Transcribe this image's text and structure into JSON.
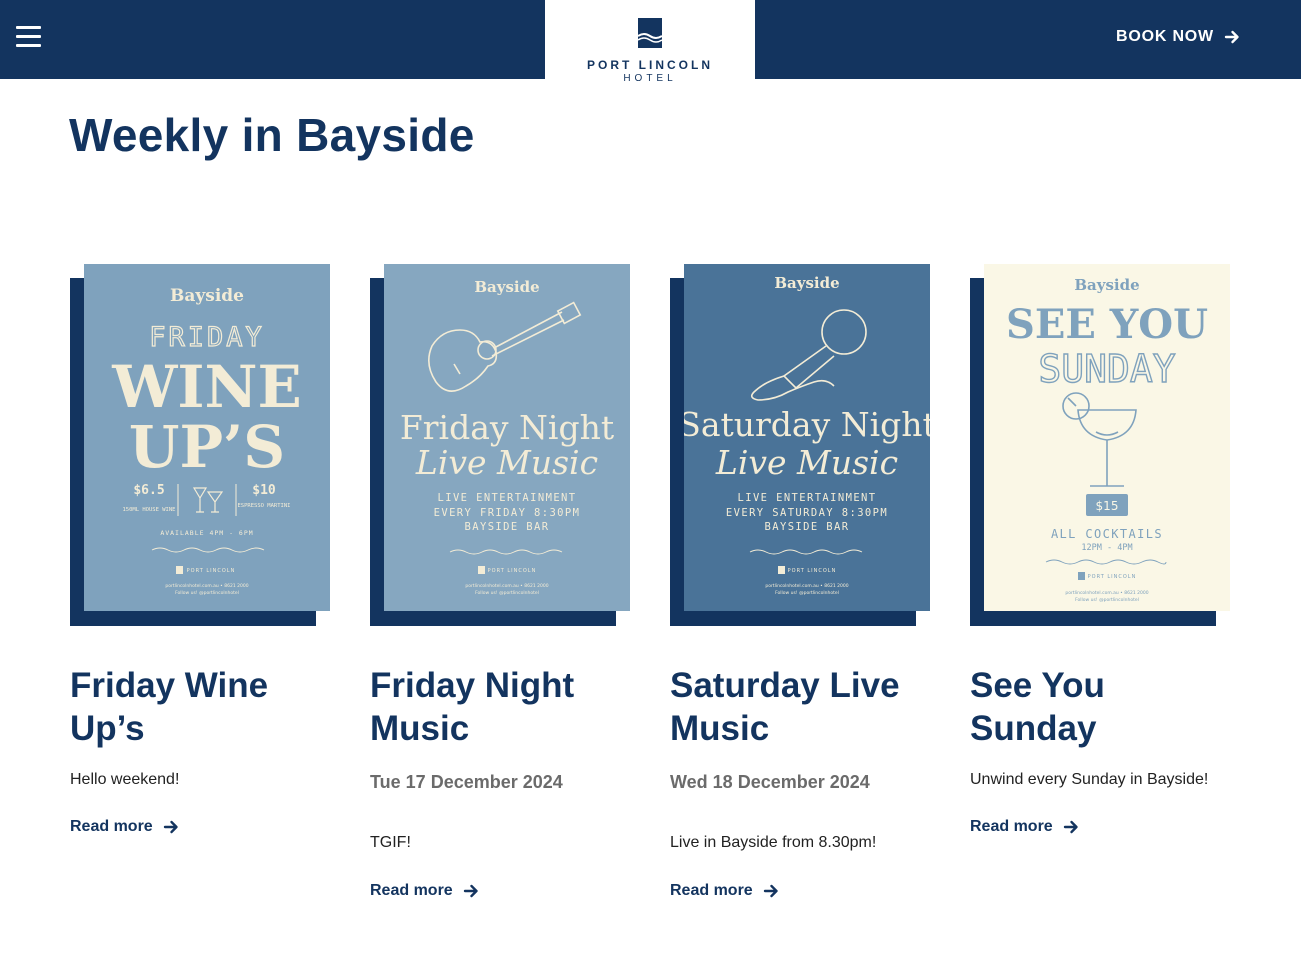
{
  "header": {
    "logo_name": "PORT LINCOLN",
    "logo_sub": "HOTEL",
    "book_now": "BOOK NOW"
  },
  "section": {
    "title": "Weekly in Bayside"
  },
  "cards": [
    {
      "title": "Friday Wine Up’s",
      "date": "",
      "description": "Hello weekend!",
      "read_more": "Read more",
      "poster": {
        "brand": "Bayside",
        "line1": "FRIDAY",
        "line2": "WINE",
        "line3": "UP’S",
        "price_left": "$6.5",
        "price_left_note": "150ML HOUSE WINE",
        "price_right": "$10",
        "price_right_note": "ESPRESSO MARTINI",
        "availability": "AVAILABLE 4PM - 6PM",
        "footer_brand": "PORT LINCOLN",
        "footer_contact": "portlincolnhotel.com.au • 8621 2000",
        "footer_follow": "Follow us! @portlincolnhotel",
        "bg": "#7fa2bd",
        "fg": "#f3ecd6"
      }
    },
    {
      "title": "Friday Night Music",
      "date": "Tue 17 December 2024",
      "description": "TGIF!",
      "read_more": "Read more",
      "poster": {
        "brand": "Bayside",
        "headline": "Friday Night",
        "subline": "Live Music",
        "info1": "LIVE ENTERTAINMENT",
        "info2": "EVERY FRIDAY 8:30PM",
        "info3": "BAYSIDE BAR",
        "footer_brand": "PORT LINCOLN",
        "footer_contact": "portlincolnhotel.com.au • 8621 2000",
        "footer_follow": "Follow us! @portlincolnhotel",
        "bg": "#86a7c0",
        "fg": "#f3ecd6"
      }
    },
    {
      "title": "Saturday Live Music",
      "date": "Wed 18 December 2024",
      "description": "Live in Bayside from 8.30pm!",
      "read_more": "Read more",
      "poster": {
        "brand": "Bayside",
        "headline": "Saturday Night",
        "subline": "Live Music",
        "info1": "LIVE ENTERTAINMENT",
        "info2": "EVERY SATURDAY 8:30PM",
        "info3": "BAYSIDE BAR",
        "footer_brand": "PORT LINCOLN",
        "footer_contact": "portlincolnhotel.com.au • 8621 2000",
        "footer_follow": "Follow us! @portlincolnhotel",
        "bg": "#4a7398",
        "fg": "#f3ecd6"
      }
    },
    {
      "title": "See You Sunday",
      "date": "",
      "description": "Unwind every Sunday in Bayside!",
      "read_more": "Read more",
      "poster": {
        "brand": "Bayside",
        "line1": "SEE YOU",
        "line2": "SUNDAY",
        "price": "$15",
        "info1": "ALL COCKTAILS",
        "info2": "12PM - 4PM",
        "footer_brand": "PORT LINCOLN",
        "footer_contact": "portlincolnhotel.com.au • 8621 2000",
        "footer_follow": "Follow us! @portlincolnhotel",
        "bg": "#faf7e6",
        "fg": "#7fa2bd"
      }
    }
  ],
  "colors": {
    "navy": "#13345f",
    "white": "#ffffff",
    "muted": "#6b6b6b"
  }
}
